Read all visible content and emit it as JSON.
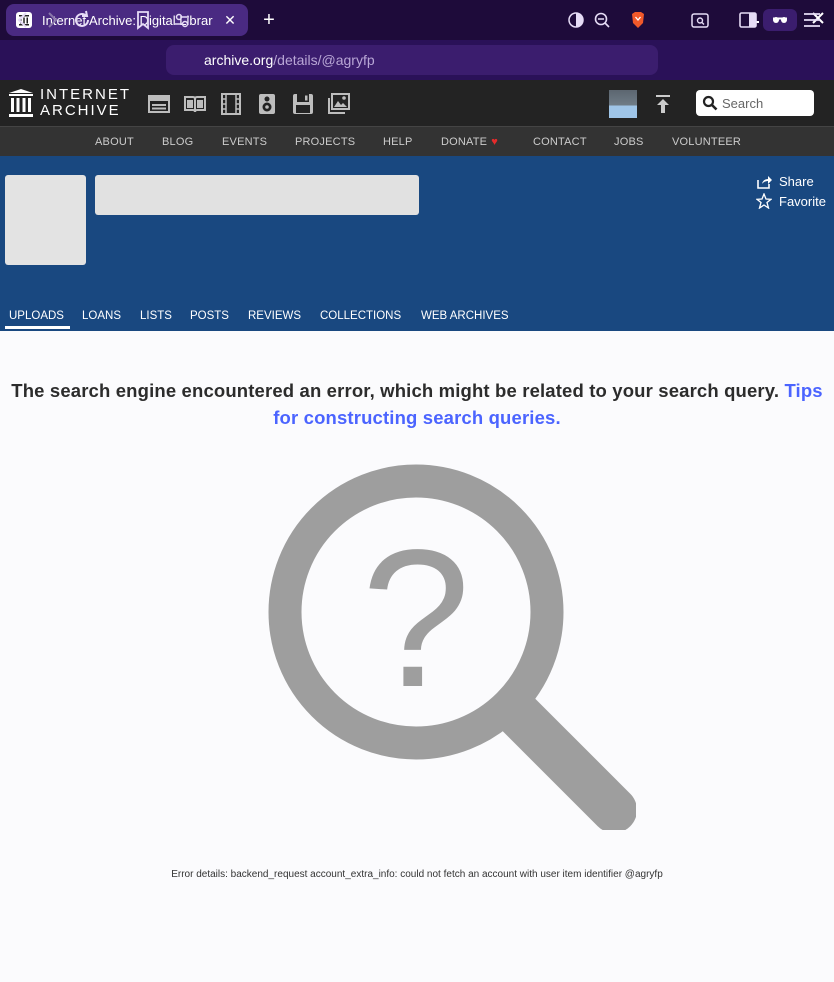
{
  "browser": {
    "tab_title": "Internet Archive: Digital Librar",
    "tab_close": "✕",
    "new_tab": "+",
    "url_host": "archive.org",
    "url_path": "/details/@agryfp"
  },
  "ia_header": {
    "logo_line1": "INTERNET",
    "logo_line2": "ARCHIVE",
    "media_icons": [
      "web-icon",
      "texts-icon",
      "video-icon",
      "audio-icon",
      "software-icon",
      "images-icon"
    ],
    "search_placeholder": "Search"
  },
  "nav": {
    "items": [
      "ABOUT",
      "BLOG",
      "EVENTS",
      "PROJECTS",
      "HELP",
      "DONATE",
      "CONTACT",
      "JOBS",
      "VOLUNTEER"
    ],
    "donate_heart": "♥"
  },
  "banner": {
    "share_label": "Share",
    "favorite_label": "Favorite",
    "tabs": [
      "UPLOADS",
      "LOANS",
      "LISTS",
      "POSTS",
      "REVIEWS",
      "COLLECTIONS",
      "WEB ARCHIVES"
    ],
    "active_tab": "UPLOADS"
  },
  "error": {
    "message": "The search engine encountered an error, which might be related to your search query. ",
    "link_text": "Tips for constructing search queries.",
    "details": "Error details: backend_request account_extra_info: could not fetch an account with user item identifier @agryfp"
  },
  "colors": {
    "banner_blue": "#194880",
    "link_blue": "#4b64ff",
    "browser_purple": "#2a1158"
  }
}
